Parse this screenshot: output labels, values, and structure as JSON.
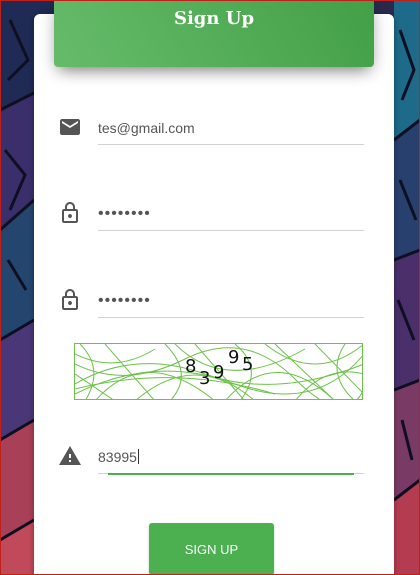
{
  "colors": {
    "accent": "#4caf50",
    "header_gradient_start": "#66bb6a",
    "header_gradient_end": "#43a047",
    "captcha_line": "#6cc24a",
    "icon": "#555555"
  },
  "header": {
    "title": "Sign Up"
  },
  "form": {
    "email": {
      "value": "tes@gmail.com",
      "icon": "envelope-icon"
    },
    "password": {
      "value": "••••••••",
      "icon": "lock-icon"
    },
    "confirm_password": {
      "value": "••••••••",
      "icon": "lock-icon"
    },
    "captcha": {
      "digits": [
        "8",
        "3",
        "9",
        "9",
        "5"
      ]
    },
    "captcha_answer": {
      "value": "83995",
      "icon": "warning-icon"
    }
  },
  "signup_button": {
    "label": "Sign Up"
  }
}
